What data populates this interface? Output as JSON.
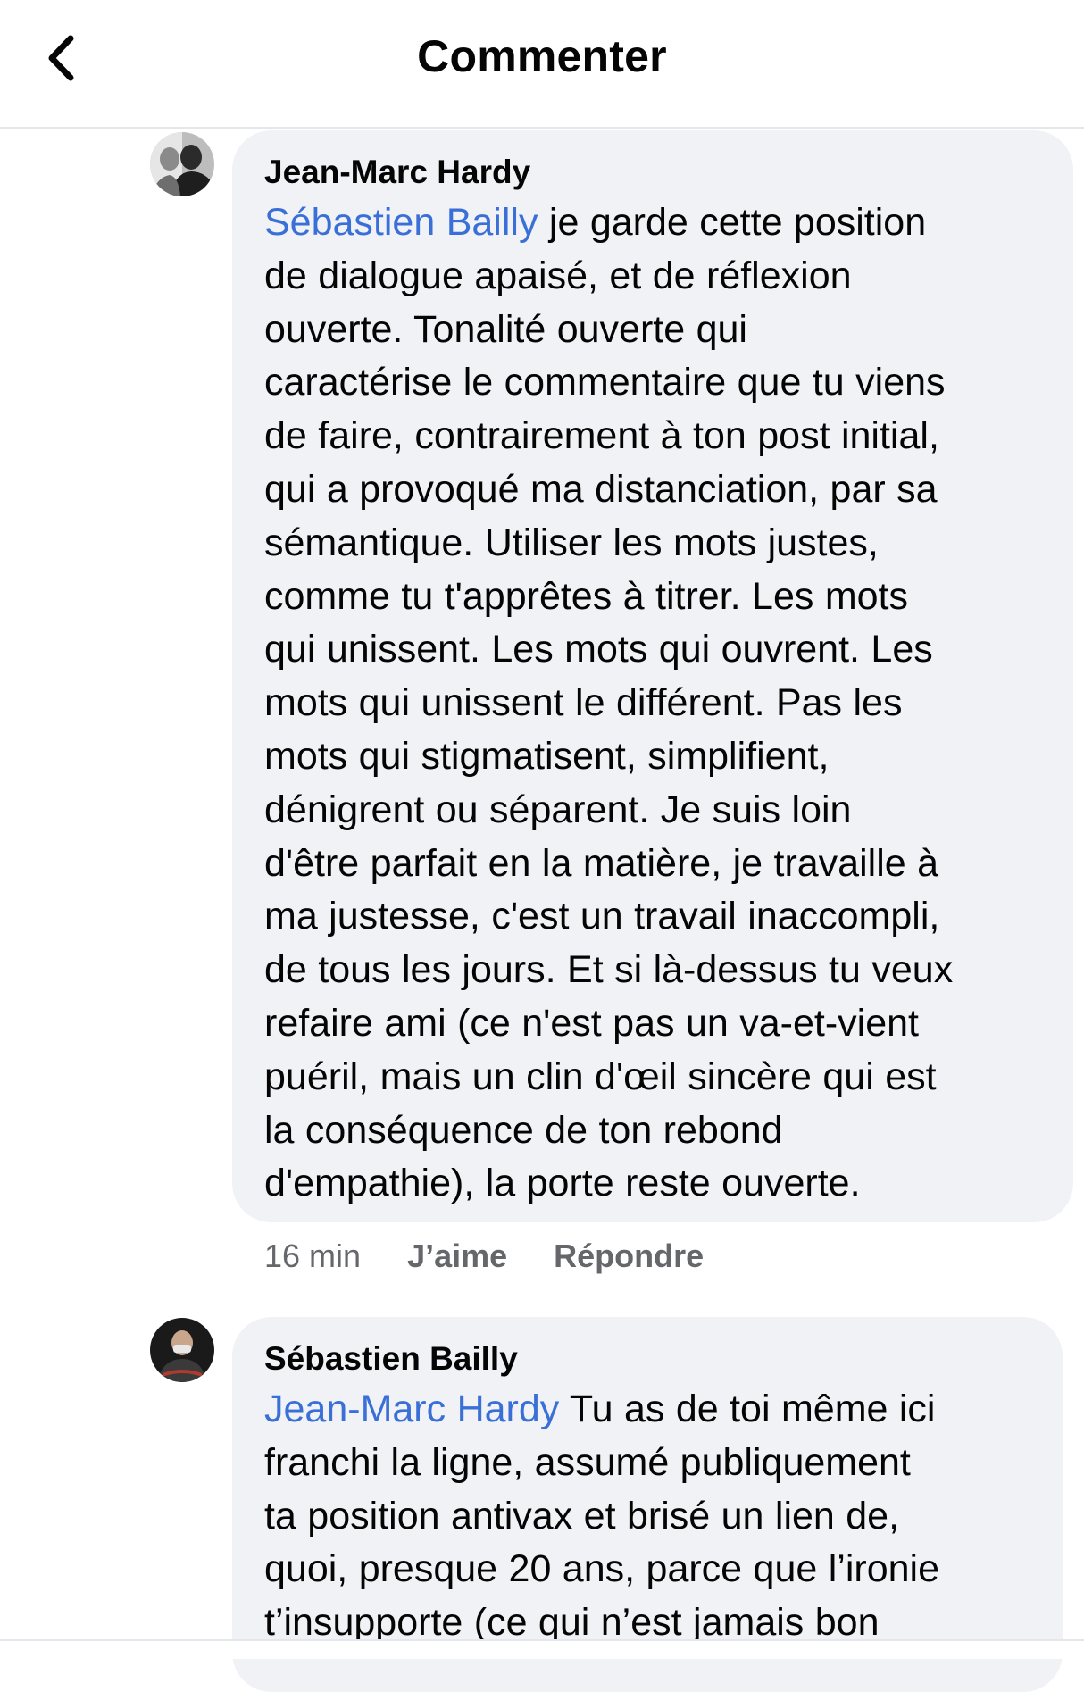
{
  "header": {
    "title": "Commenter",
    "back_icon": "chevron-left-icon"
  },
  "comments": [
    {
      "author": "Jean-Marc Hardy",
      "mention": "Sébastien Bailly",
      "lines": [
        " je garde cette position",
        "de dialogue apaisé, et de réflexion",
        "ouverte. Tonalité ouverte qui",
        "caractérise le commentaire que tu viens",
        "de faire, contrairement à ton post initial,",
        "qui a provoqué ma distanciation, par sa",
        "sémantique. Utiliser les mots justes,",
        "comme tu t'apprêtes à titrer. Les mots",
        "qui unissent. Les mots qui ouvrent. Les",
        "mots qui unissent le différent. Pas les",
        "mots qui stigmatisent, simplifient,",
        "dénigrent ou séparent. Je suis loin",
        "d'être parfait en la matière, je travaille à",
        "ma justesse, c'est un travail inaccompli,",
        "de tous les jours. Et si là-dessus tu veux",
        "refaire ami (ce n'est pas un va-et-vient",
        "puéril, mais un clin d'œil sincère qui est",
        "la conséquence de ton rebond",
        "d'empathie), la porte reste ouverte."
      ],
      "time": "16 min",
      "like_label": "J’aime",
      "reply_label": "Répondre"
    },
    {
      "author": "Sébastien Bailly",
      "mention": "Jean-Marc Hardy",
      "lines": [
        " Tu as de toi même ici",
        "franchi la ligne, assumé publiquement",
        "ta position antivax et brisé un lien de,",
        "quoi, presque 20 ans, parce que l’ironie",
        "t’insupporte (ce qui n’est jamais bon"
      ]
    }
  ],
  "colors": {
    "mention": "#3a6fd8",
    "bubble": "#f0f2f5",
    "meta": "#65676b"
  }
}
